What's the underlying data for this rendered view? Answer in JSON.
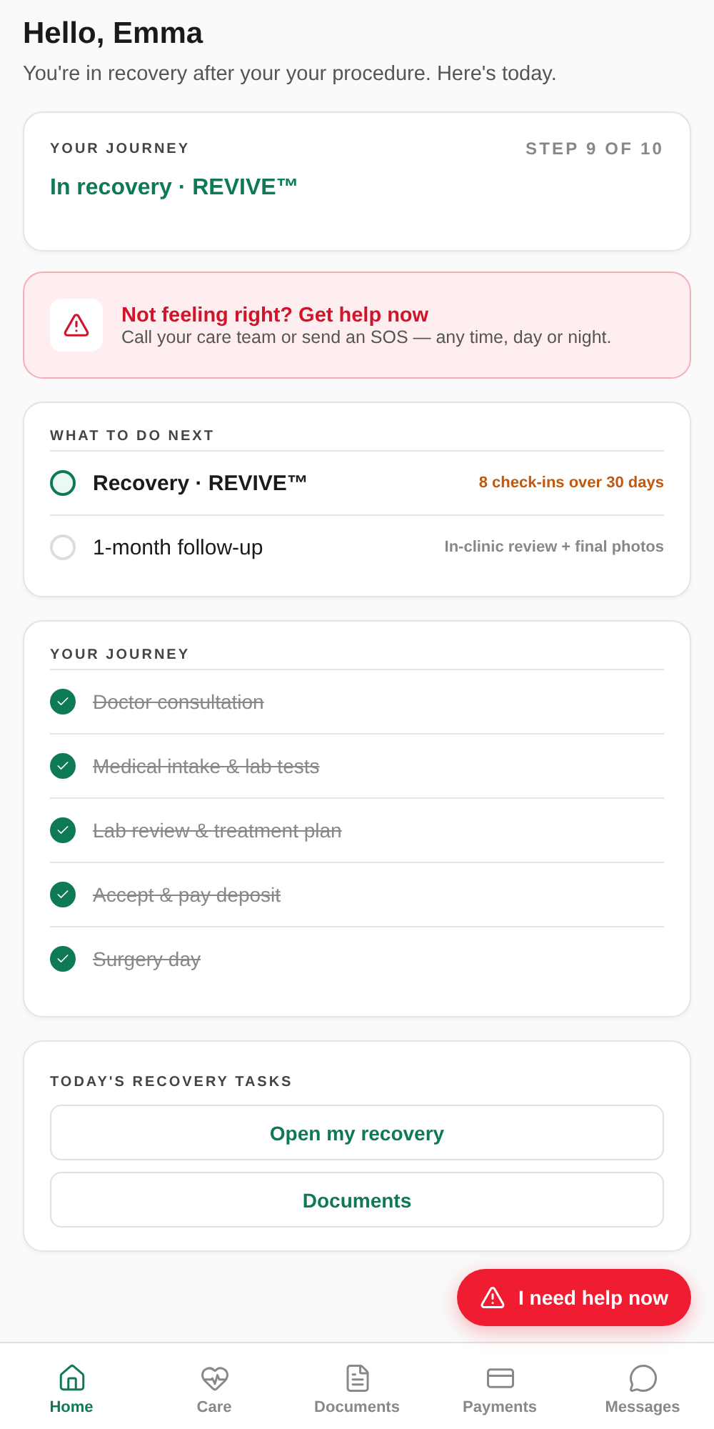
{
  "greeting": "Hello, Emma",
  "subtitle": "You're in recovery after your your procedure. Here's today.",
  "journey_summary": {
    "label": "YOUR JOURNEY",
    "step": "STEP 9 OF 10",
    "status": "In recovery · REVIVE™"
  },
  "alert": {
    "title": "Not feeling right? Get help now",
    "text": "Call your care team or send an SOS — any time, day or night."
  },
  "next": {
    "label": "WHAT TO DO NEXT",
    "items": [
      {
        "title": "Recovery · REVIVE™",
        "note": "8 check-ins over 30 days",
        "active": true
      },
      {
        "title": "1-month follow-up",
        "note": "In-clinic review + final photos",
        "active": false
      }
    ]
  },
  "journey": {
    "label": "YOUR JOURNEY",
    "steps": [
      {
        "title": "Doctor consultation",
        "done": true
      },
      {
        "title": "Medical intake & lab tests",
        "done": true
      },
      {
        "title": "Lab review & treatment plan",
        "done": true
      },
      {
        "title": "Accept & pay deposit",
        "done": true
      },
      {
        "title": "Surgery day",
        "done": true
      }
    ]
  },
  "tasks": {
    "label": "TODAY'S RECOVERY TASKS",
    "buttons": [
      "Open my recovery",
      "Documents"
    ]
  },
  "sos_button": "I need help now",
  "nav": [
    {
      "label": "Home",
      "selected": true
    },
    {
      "label": "Care",
      "selected": false
    },
    {
      "label": "Documents",
      "selected": false
    },
    {
      "label": "Payments",
      "selected": false
    },
    {
      "label": "Messages",
      "selected": false
    }
  ]
}
